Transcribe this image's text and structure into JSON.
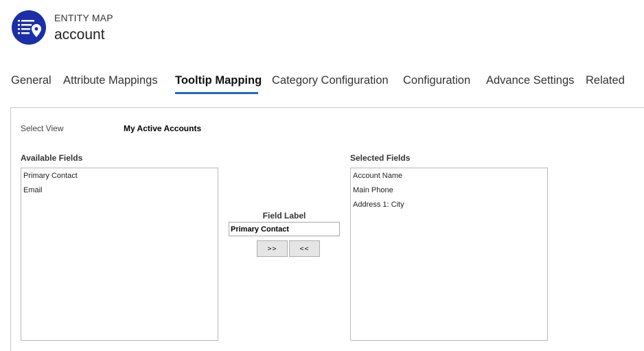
{
  "header": {
    "entity_type": "ENTITY MAP",
    "entity_name": "account",
    "icon": "entity-map-icon",
    "icon_color": "#1b2fa8"
  },
  "tabs": [
    {
      "label": "General"
    },
    {
      "label": "Attribute Mappings"
    },
    {
      "label": "Tooltip Mapping",
      "active": true
    },
    {
      "label": "Category Configuration"
    },
    {
      "label": "Configuration"
    },
    {
      "label": "Advance Settings"
    },
    {
      "label": "Related"
    }
  ],
  "accent_color": "#2266cc",
  "select_view": {
    "label": "Select View",
    "value": "My Active Accounts"
  },
  "available_fields": {
    "heading": "Available Fields",
    "items": [
      "Primary Contact",
      "Email"
    ]
  },
  "field_label": {
    "caption": "Field Label",
    "value": "Primary Contact"
  },
  "buttons": {
    "add": ">>",
    "remove": "<<"
  },
  "selected_fields": {
    "heading": "Selected Fields",
    "items": [
      "Account Name",
      "Main Phone",
      "Address 1: City"
    ]
  }
}
